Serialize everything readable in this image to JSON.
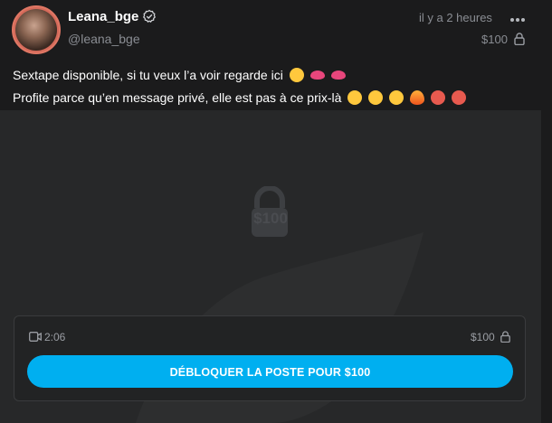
{
  "post": {
    "author_name": "Leana_bge",
    "handle": "@leana_bge",
    "time": "il y a 2 heures",
    "price": "$100",
    "text_line1": "Sextape disponible, si tu veux l’a voir regarde ici",
    "text_line2": "Profite parce qu’en message privé, elle est pas à ce prix-là",
    "line1_emojis": [
      "hugging-face-emoji",
      "lips-emoji",
      "lips-emoji"
    ],
    "line2_emojis": [
      "face-emoji",
      "face-emoji",
      "face-emoji",
      "fire-emoji",
      "angry-face-emoji",
      "angry-face-emoji"
    ]
  },
  "media": {
    "price_label": "$100",
    "duration": "2:06",
    "box_price": "$100",
    "unlock_label": "DÉBLOQUER LA POSTE POUR $100"
  },
  "colors": {
    "accent": "#00aff0",
    "background": "#1b1b1c",
    "media_bg": "#272829",
    "muted_text": "#8a8d93"
  }
}
